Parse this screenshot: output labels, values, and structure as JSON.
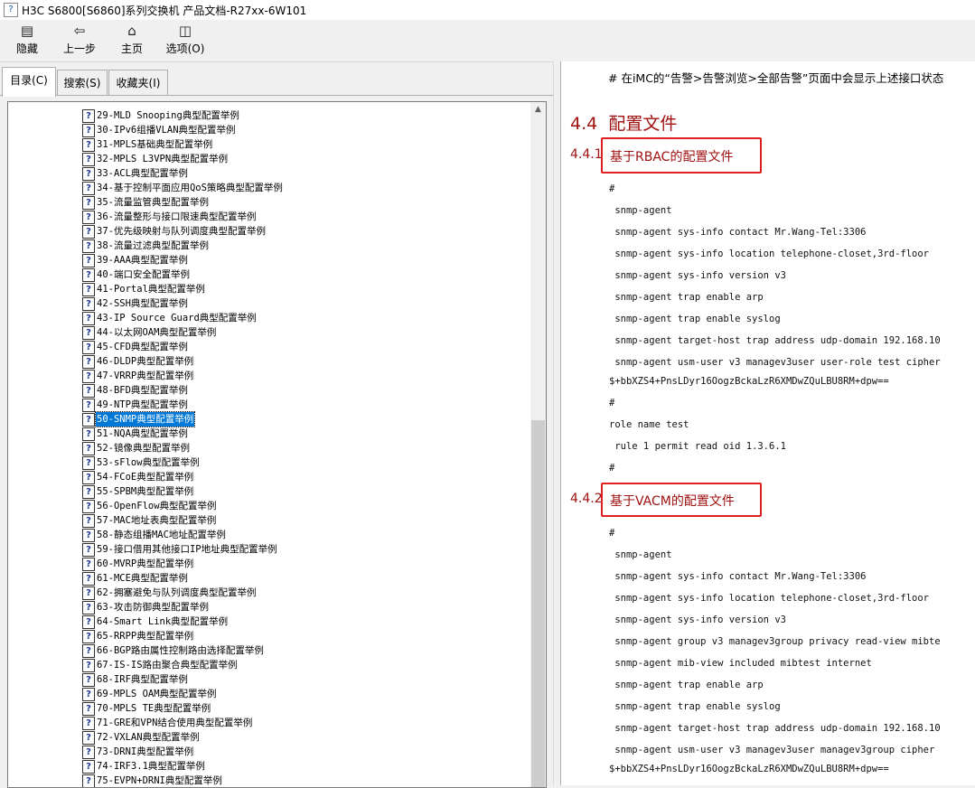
{
  "window": {
    "title": "H3C S6800[S6860]系列交换机 产品文档-R27xx-6W101"
  },
  "toolbar": [
    {
      "label": "隐藏",
      "icon": "hide-icon"
    },
    {
      "label": "上一步",
      "icon": "back-arrow-icon"
    },
    {
      "label": "主页",
      "icon": "home-icon"
    },
    {
      "label": "选项(O)",
      "icon": "options-icon"
    }
  ],
  "tabs": [
    {
      "label": "目录(C)"
    },
    {
      "label": "搜索(S)"
    },
    {
      "label": "收藏夹(I)"
    }
  ],
  "tree": {
    "selected_index": 21,
    "items": [
      "29-MLD Snooping典型配置举例",
      "30-IPv6组播VLAN典型配置举例",
      "31-MPLS基础典型配置举例",
      "32-MPLS L3VPN典型配置举例",
      "33-ACL典型配置举例",
      "34-基于控制平面应用QoS策略典型配置举例",
      "35-流量监管典型配置举例",
      "36-流量整形与接口限速典型配置举例",
      "37-优先级映射与队列调度典型配置举例",
      "38-流量过滤典型配置举例",
      "39-AAA典型配置举例",
      "40-端口安全配置举例",
      "41-Portal典型配置举例",
      "42-SSH典型配置举例",
      "43-IP Source Guard典型配置举例",
      "44-以太网OAM典型配置举例",
      "45-CFD典型配置举例",
      "46-DLDP典型配置举例",
      "47-VRRP典型配置举例",
      "48-BFD典型配置举例",
      "49-NTP典型配置举例",
      "50-SNMP典型配置举例",
      "51-NQA典型配置举例",
      "52-镜像典型配置举例",
      "53-sFlow典型配置举例",
      "54-FCoE典型配置举例",
      "55-SPBM典型配置举例",
      "56-OpenFlow典型配置举例",
      "57-MAC地址表典型配置举例",
      "58-静态组播MAC地址配置举例",
      "59-接口借用其他接口IP地址典型配置举例",
      "60-MVRP典型配置举例",
      "61-MCE典型配置举例",
      "62-拥塞避免与队列调度典型配置举例",
      "63-攻击防御典型配置举例",
      "64-Smart Link典型配置举例",
      "65-RRPP典型配置举例",
      "66-BGP路由属性控制路由选择配置举例",
      "67-IS-IS路由聚合典型配置举例",
      "68-IRF典型配置举例",
      "69-MPLS OAM典型配置举例",
      "70-MPLS TE典型配置举例",
      "71-GRE和VPN结合使用典型配置举例",
      "72-VXLAN典型配置举例",
      "73-DRNI典型配置举例",
      "74-IRF3.1典型配置举例",
      "75-EVPN+DRNI典型配置举例"
    ]
  },
  "content": {
    "intro": "# 在iMC的“告警>告警浏览>全部告警”页面中会显示上述接口状态",
    "section": {
      "num": "4.4",
      "title": "配置文件"
    },
    "sub1": {
      "num": "4.4.1",
      "title": "基于RBAC的配置文件"
    },
    "config1": [
      "#",
      " snmp-agent",
      " snmp-agent sys-info contact Mr.Wang-Tel:3306",
      " snmp-agent sys-info location telephone-closet,3rd-floor",
      " snmp-agent sys-info version v3",
      " snmp-agent trap enable arp",
      " snmp-agent trap enable syslog",
      " snmp-agent target-host trap address udp-domain 192.168.10",
      " snmp-agent usm-user v3 managev3user user-role test cipher",
      "$+bbXZS4+PnsLDyr16OogzBckaLzR6XMDwZQuLBU8RM+dpw==",
      "#",
      "role name test",
      " rule 1 permit read oid 1.3.6.1",
      "#"
    ],
    "sub2": {
      "num": "4.4.2",
      "title": "基于VACM的配置文件"
    },
    "config2": [
      "#",
      " snmp-agent",
      " snmp-agent sys-info contact Mr.Wang-Tel:3306",
      " snmp-agent sys-info location telephone-closet,3rd-floor",
      " snmp-agent sys-info version v3",
      " snmp-agent group v3 managev3group privacy read-view mibte",
      " snmp-agent mib-view included mibtest internet",
      " snmp-agent trap enable arp",
      " snmp-agent trap enable syslog",
      " snmp-agent target-host trap address udp-domain 192.168.10",
      " snmp-agent usm-user v3 managev3user managev3group cipher",
      "$+bbXZS4+PnsLDyr16OogzBckaLzR6XMDwZQuLBU8RM+dpw=="
    ]
  },
  "colors": {
    "heading": "#a01010",
    "highlight_box": "#e02020",
    "selection": "#0078d7"
  }
}
